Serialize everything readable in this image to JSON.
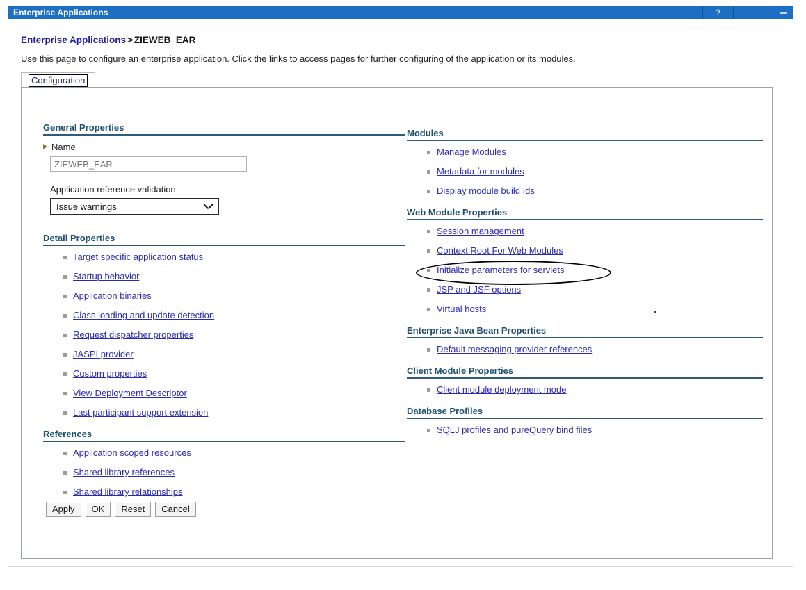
{
  "window": {
    "title": "Enterprise Applications",
    "help_label": "?",
    "minimize_label": "",
    "accent_color": "#1d6fc4"
  },
  "breadcrumb": {
    "root_link": "Enterprise Applications",
    "separator": ">",
    "current": "ZIEWEB_EAR"
  },
  "page": {
    "description": "Use this page to configure an enterprise application. Click the links to access pages for further configuring of the application or its modules."
  },
  "tabs": [
    {
      "label": "Configuration",
      "selected": true
    }
  ],
  "left_column": {
    "general_properties": {
      "heading": "General Properties",
      "name_label": "Name",
      "name_value": "ZIEWEB_EAR",
      "name_placeholder": "ZIEWEB_EAR",
      "validation_label": "Application reference validation",
      "validation_value": "Issue warnings",
      "validation_options": [
        "Issue warnings"
      ]
    },
    "detail_properties": {
      "heading": "Detail Properties",
      "links": [
        "Target specific application status",
        "Startup behavior",
        "Application binaries",
        "Class loading and update detection",
        "Request dispatcher properties",
        "JASPI provider",
        "Custom properties",
        "View Deployment Descriptor",
        "Last participant support extension"
      ]
    },
    "references": {
      "heading": "References",
      "links": [
        "Application scoped resources",
        "Shared library references",
        "Shared library relationships"
      ]
    }
  },
  "right_column": {
    "modules": {
      "heading": "Modules",
      "links": [
        "Manage Modules",
        "Metadata for modules",
        "Display module build Ids"
      ]
    },
    "web_module_properties": {
      "heading": "Web Module Properties",
      "links": [
        "Session management",
        "Context Root For Web Modules",
        "Initialize parameters for servlets",
        "JSP and JSF options",
        "Virtual hosts"
      ]
    },
    "ejb_properties": {
      "heading": "Enterprise Java Bean Properties",
      "links": [
        "Default messaging provider references"
      ]
    },
    "client_module_properties": {
      "heading": "Client Module Properties",
      "links": [
        "Client module deployment mode"
      ]
    },
    "database_profiles": {
      "heading": "Database Profiles",
      "links": [
        "SQLJ profiles and pureQuery bind files"
      ]
    }
  },
  "buttons": [
    {
      "label": "Apply"
    },
    {
      "label": "OK"
    },
    {
      "label": "Reset"
    },
    {
      "label": "Cancel"
    }
  ],
  "annotation": {
    "target_link": "Initialize parameters for servlets",
    "shape": "ellipse",
    "color": "#000000"
  }
}
